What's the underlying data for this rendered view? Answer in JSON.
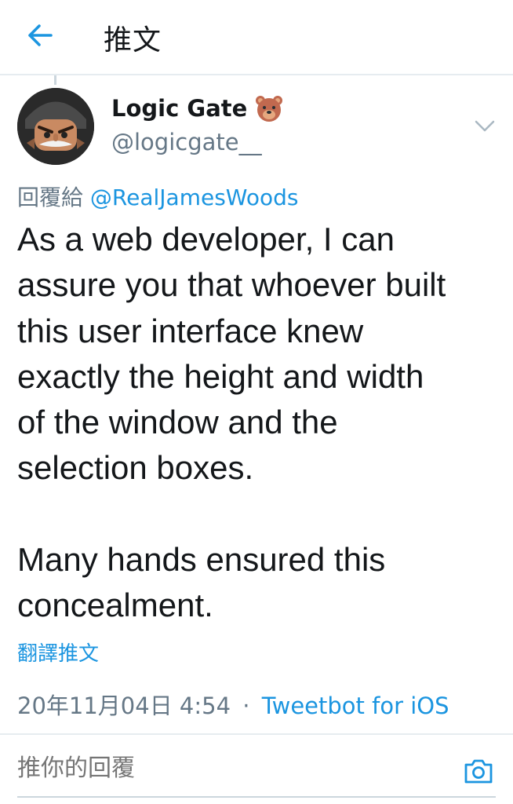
{
  "header": {
    "back_icon": "arrow-left-icon",
    "title": "推文"
  },
  "tweet": {
    "author": {
      "display_name": "Logic Gate",
      "emoji": "🐻",
      "handle": "@logicgate__"
    },
    "reply_prefix": "回覆給",
    "reply_mention": "@RealJamesWoods",
    "text": "As a web developer, I can\nassure you that whoever built\nthis user interface knew\nexactly the height and width\nof the window and the\nselection boxes.\n\nMany hands ensured this\nconcealment.",
    "translate_label": "翻譯推文",
    "timestamp": "20年11月04日 4:54",
    "separator": "·",
    "client": "Tweetbot for iOS"
  },
  "reply_bar": {
    "placeholder": "推你的回覆",
    "camera_icon": "camera-icon"
  },
  "colors": {
    "accent": "#1b95e0",
    "muted": "#657786",
    "text": "#14171a",
    "divider": "#e6ecf0"
  }
}
